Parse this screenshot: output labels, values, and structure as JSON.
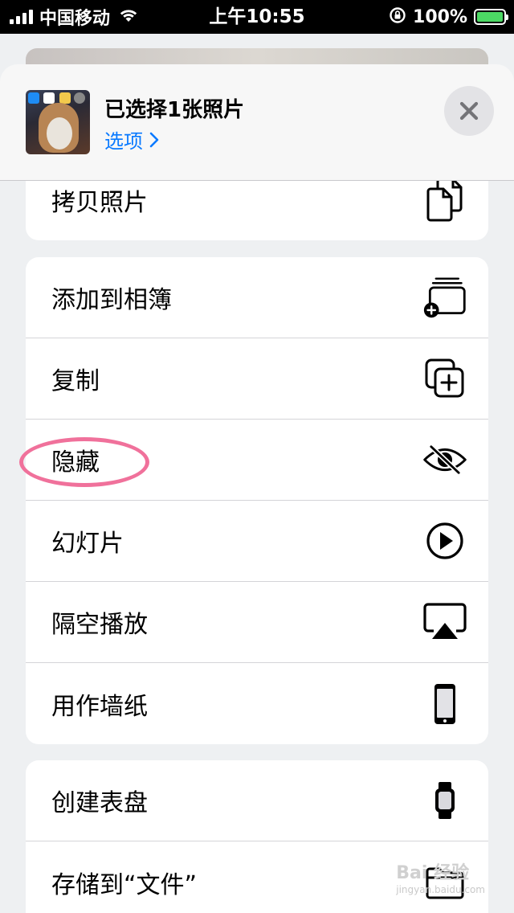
{
  "status_bar": {
    "carrier": "中国移动",
    "time": "上午10:55",
    "battery_percent": "100%"
  },
  "header": {
    "title": "已选择1张照片",
    "options_label": "选项",
    "close_icon": "close-icon"
  },
  "groups": [
    {
      "items": [
        {
          "label": "拷贝照片",
          "icon": "copy-icon"
        }
      ]
    },
    {
      "items": [
        {
          "label": "添加到相簿",
          "icon": "add-to-album-icon"
        },
        {
          "label": "复制",
          "icon": "duplicate-icon"
        },
        {
          "label": "隐藏",
          "icon": "eye-slash-icon"
        },
        {
          "label": "幻灯片",
          "icon": "play-icon"
        },
        {
          "label": "隔空播放",
          "icon": "airplay-icon"
        },
        {
          "label": "用作墙纸",
          "icon": "phone-icon"
        }
      ]
    },
    {
      "items": [
        {
          "label": "创建表盘",
          "icon": "watch-icon"
        },
        {
          "label": "存储到“文件”",
          "icon": "folder-icon"
        }
      ]
    }
  ],
  "watermark": {
    "brand": "Bai 经验",
    "url": "jingyan.baidu.com"
  },
  "colors": {
    "accent": "#0a7aff",
    "annotation": "#f0719b",
    "battery_fill": "#4cd964"
  }
}
